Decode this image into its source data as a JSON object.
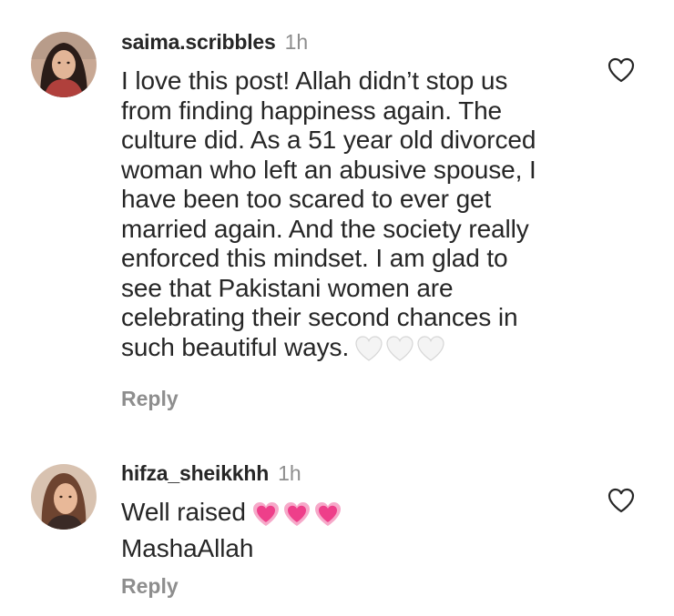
{
  "comments": [
    {
      "username": "saima.scribbles",
      "time": "1h",
      "text_lines": [
        "I love this post! Allah didn’t stop us",
        "from finding happiness again. The",
        "culture did. As a 51 year old divorced",
        "woman who left an abusive spouse, I",
        "have been too scared to ever get",
        "married again. And the society really",
        "enforced this mindset. I am glad to",
        "see that Pakistani women are",
        "celebrating their second chances in",
        "such beautiful ways."
      ],
      "emojis": [
        "white-heart-icon",
        "white-heart-icon",
        "white-heart-icon"
      ],
      "reply_label": "Reply",
      "avatar_colors": {
        "bg": "#c8a894",
        "hair": "#2a1c18",
        "face": "#e2b597",
        "shirt": "#b0403c"
      }
    },
    {
      "username": "hifza_sheikkhh",
      "time": "1h",
      "text_lines": [
        "Well raised",
        "MashaAllah"
      ],
      "emojis": [
        "growing-heart-icon",
        "growing-heart-icon",
        "growing-heart-icon"
      ],
      "reply_label": "Reply",
      "avatar_colors": {
        "bg": "#d8c2b0",
        "hair": "#6e4430",
        "face": "#e8b898",
        "shirt": "#3a2a26"
      }
    }
  ],
  "colors": {
    "text": "#262626",
    "muted": "#8e8e8e",
    "heart_outline": "#262626",
    "pink_heart": "#f0428c",
    "white_heart": "#f2f2f2"
  }
}
